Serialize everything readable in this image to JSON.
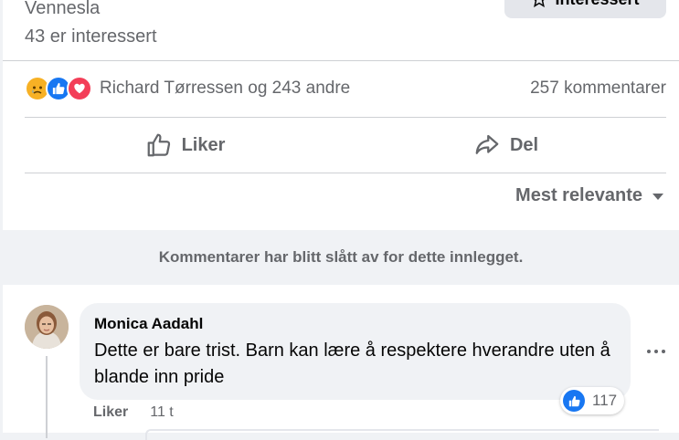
{
  "event": {
    "location": "Vennesla",
    "interested_count": "43 er interessert",
    "interest_button": "Interessert"
  },
  "reactions": {
    "icons": [
      "sad-icon",
      "like-icon",
      "love-icon"
    ],
    "summary": "Richard Tørressen og 243 andre",
    "comments": "257 kommentarer",
    "colors": {
      "like": "#1877f2",
      "love": "#f33e58",
      "sad": "#f7b125"
    }
  },
  "actions": {
    "like_label": "Liker",
    "share_label": "Del"
  },
  "sort": {
    "label": "Mest relevante"
  },
  "notice": "Kommentarer har blitt slått av for dette innlegget.",
  "comment": {
    "author": "Monica Aadahl",
    "text": "Dette er bare trist. Barn kan lære å respektere hverandre uten å blande inn pride",
    "reaction_count": "117",
    "like_label": "Liker",
    "time": "11 t"
  }
}
